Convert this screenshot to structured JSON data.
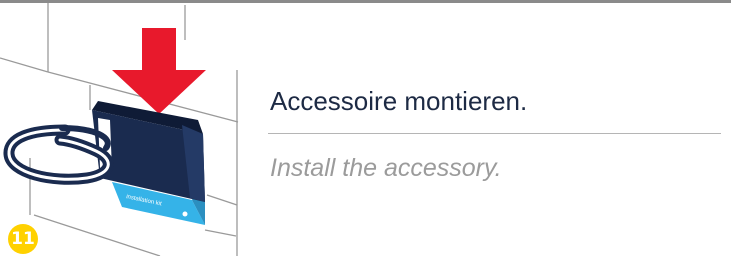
{
  "step": {
    "number": "11"
  },
  "instruction": {
    "german": "Accessoire montieren.",
    "english": "Install the accessory."
  },
  "illustration": {
    "label_text": "installation kit",
    "colors": {
      "arrow": "#e8192c",
      "holder": "#1a2b4f",
      "label": "#35b3e8",
      "badge": "#ffd100"
    }
  }
}
